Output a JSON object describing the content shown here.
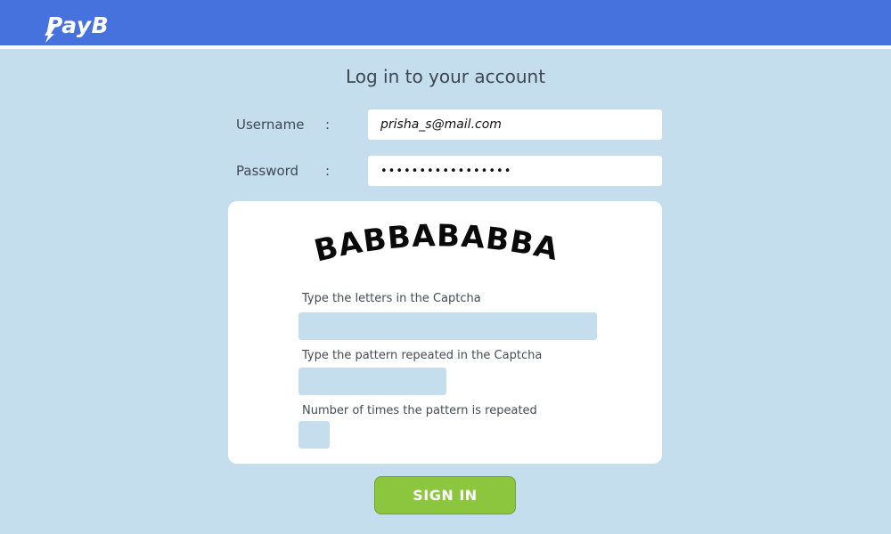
{
  "header": {
    "logo_text": "PayB",
    "brand_color": "#4672de"
  },
  "login": {
    "title": "Log in to your account",
    "username_label": "Username",
    "username_colon": ":",
    "username_value": "prisha_s@mail.com",
    "password_label": "Password",
    "password_colon": ":",
    "password_value": "•••••••••••••••••"
  },
  "captcha": {
    "image_text": "BABBABABBA",
    "letters_label": "Type the letters in the Captcha",
    "letters_value": "",
    "pattern_label": "Type the pattern repeated in the Captcha",
    "pattern_value": "",
    "count_label": "Number of times the pattern is repeated",
    "count_value": ""
  },
  "actions": {
    "signin_label": "SIGN IN",
    "signin_color": "#8cc63f"
  }
}
